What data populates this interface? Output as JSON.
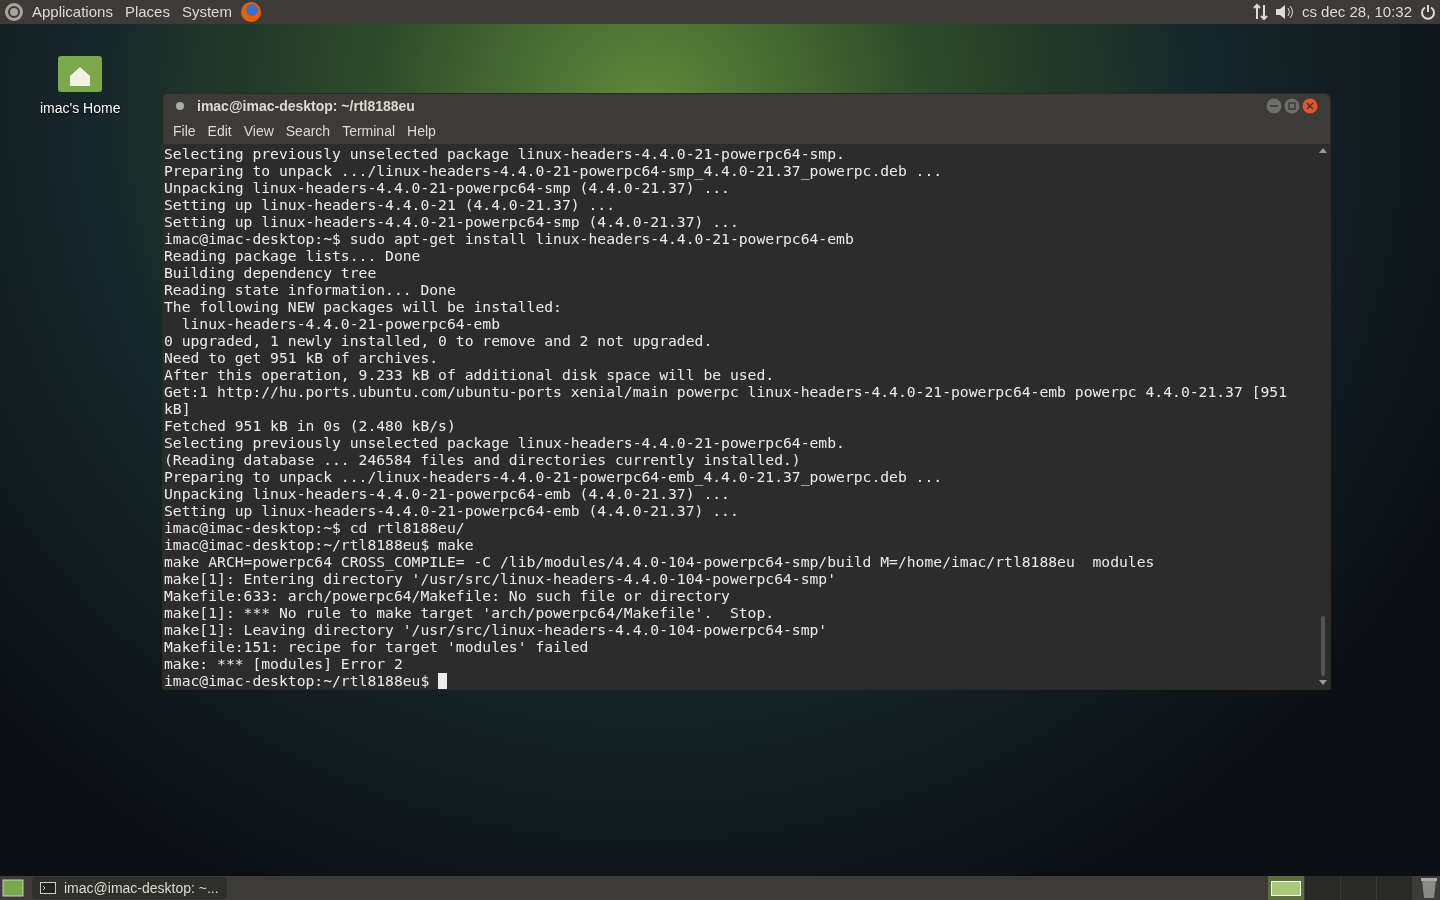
{
  "top_panel": {
    "menus": [
      "Applications",
      "Places",
      "System"
    ],
    "clock": "cs dec 28, 10:32"
  },
  "desktop_icons": [
    {
      "label": "imac's Home"
    }
  ],
  "terminal": {
    "title": "imac@imac-desktop: ~/rtl8188eu",
    "menu": [
      "File",
      "Edit",
      "View",
      "Search",
      "Terminal",
      "Help"
    ],
    "lines": [
      "Selecting previously unselected package linux-headers-4.4.0-21-powerpc64-smp.",
      "Preparing to unpack .../linux-headers-4.4.0-21-powerpc64-smp_4.4.0-21.37_powerpc.deb ...",
      "Unpacking linux-headers-4.4.0-21-powerpc64-smp (4.4.0-21.37) ...",
      "Setting up linux-headers-4.4.0-21 (4.4.0-21.37) ...",
      "Setting up linux-headers-4.4.0-21-powerpc64-smp (4.4.0-21.37) ...",
      "imac@imac-desktop:~$ sudo apt-get install linux-headers-4.4.0-21-powerpc64-emb",
      "Reading package lists... Done",
      "Building dependency tree",
      "Reading state information... Done",
      "The following NEW packages will be installed:",
      "  linux-headers-4.4.0-21-powerpc64-emb",
      "0 upgraded, 1 newly installed, 0 to remove and 2 not upgraded.",
      "Need to get 951 kB of archives.",
      "After this operation, 9.233 kB of additional disk space will be used.",
      "Get:1 http://hu.ports.ubuntu.com/ubuntu-ports xenial/main powerpc linux-headers-4.4.0-21-powerpc64-emb powerpc 4.4.0-21.37 [951",
      "kB]",
      "Fetched 951 kB in 0s (2.480 kB/s)",
      "Selecting previously unselected package linux-headers-4.4.0-21-powerpc64-emb.",
      "(Reading database ... 246584 files and directories currently installed.)",
      "Preparing to unpack .../linux-headers-4.4.0-21-powerpc64-emb_4.4.0-21.37_powerpc.deb ...",
      "Unpacking linux-headers-4.4.0-21-powerpc64-emb (4.4.0-21.37) ...",
      "Setting up linux-headers-4.4.0-21-powerpc64-emb (4.4.0-21.37) ...",
      "imac@imac-desktop:~$ cd rtl8188eu/",
      "imac@imac-desktop:~/rtl8188eu$ make",
      "make ARCH=powerpc64 CROSS_COMPILE= -C /lib/modules/4.4.0-104-powerpc64-smp/build M=/home/imac/rtl8188eu  modules",
      "make[1]: Entering directory '/usr/src/linux-headers-4.4.0-104-powerpc64-smp'",
      "Makefile:633: arch/powerpc64/Makefile: No such file or directory",
      "make[1]: *** No rule to make target 'arch/powerpc64/Makefile'.  Stop.",
      "make[1]: Leaving directory '/usr/src/linux-headers-4.4.0-104-powerpc64-smp'",
      "Makefile:151: recipe for target 'modules' failed",
      "make: *** [modules] Error 2"
    ],
    "prompt": "imac@imac-desktop:~/rtl8188eu$ "
  },
  "bottom_panel": {
    "tasks": [
      {
        "label": "imac@imac-desktop: ~..."
      }
    ],
    "workspaces": [
      {
        "selected": true
      },
      {
        "selected": false
      },
      {
        "selected": false
      },
      {
        "selected": false
      }
    ]
  }
}
